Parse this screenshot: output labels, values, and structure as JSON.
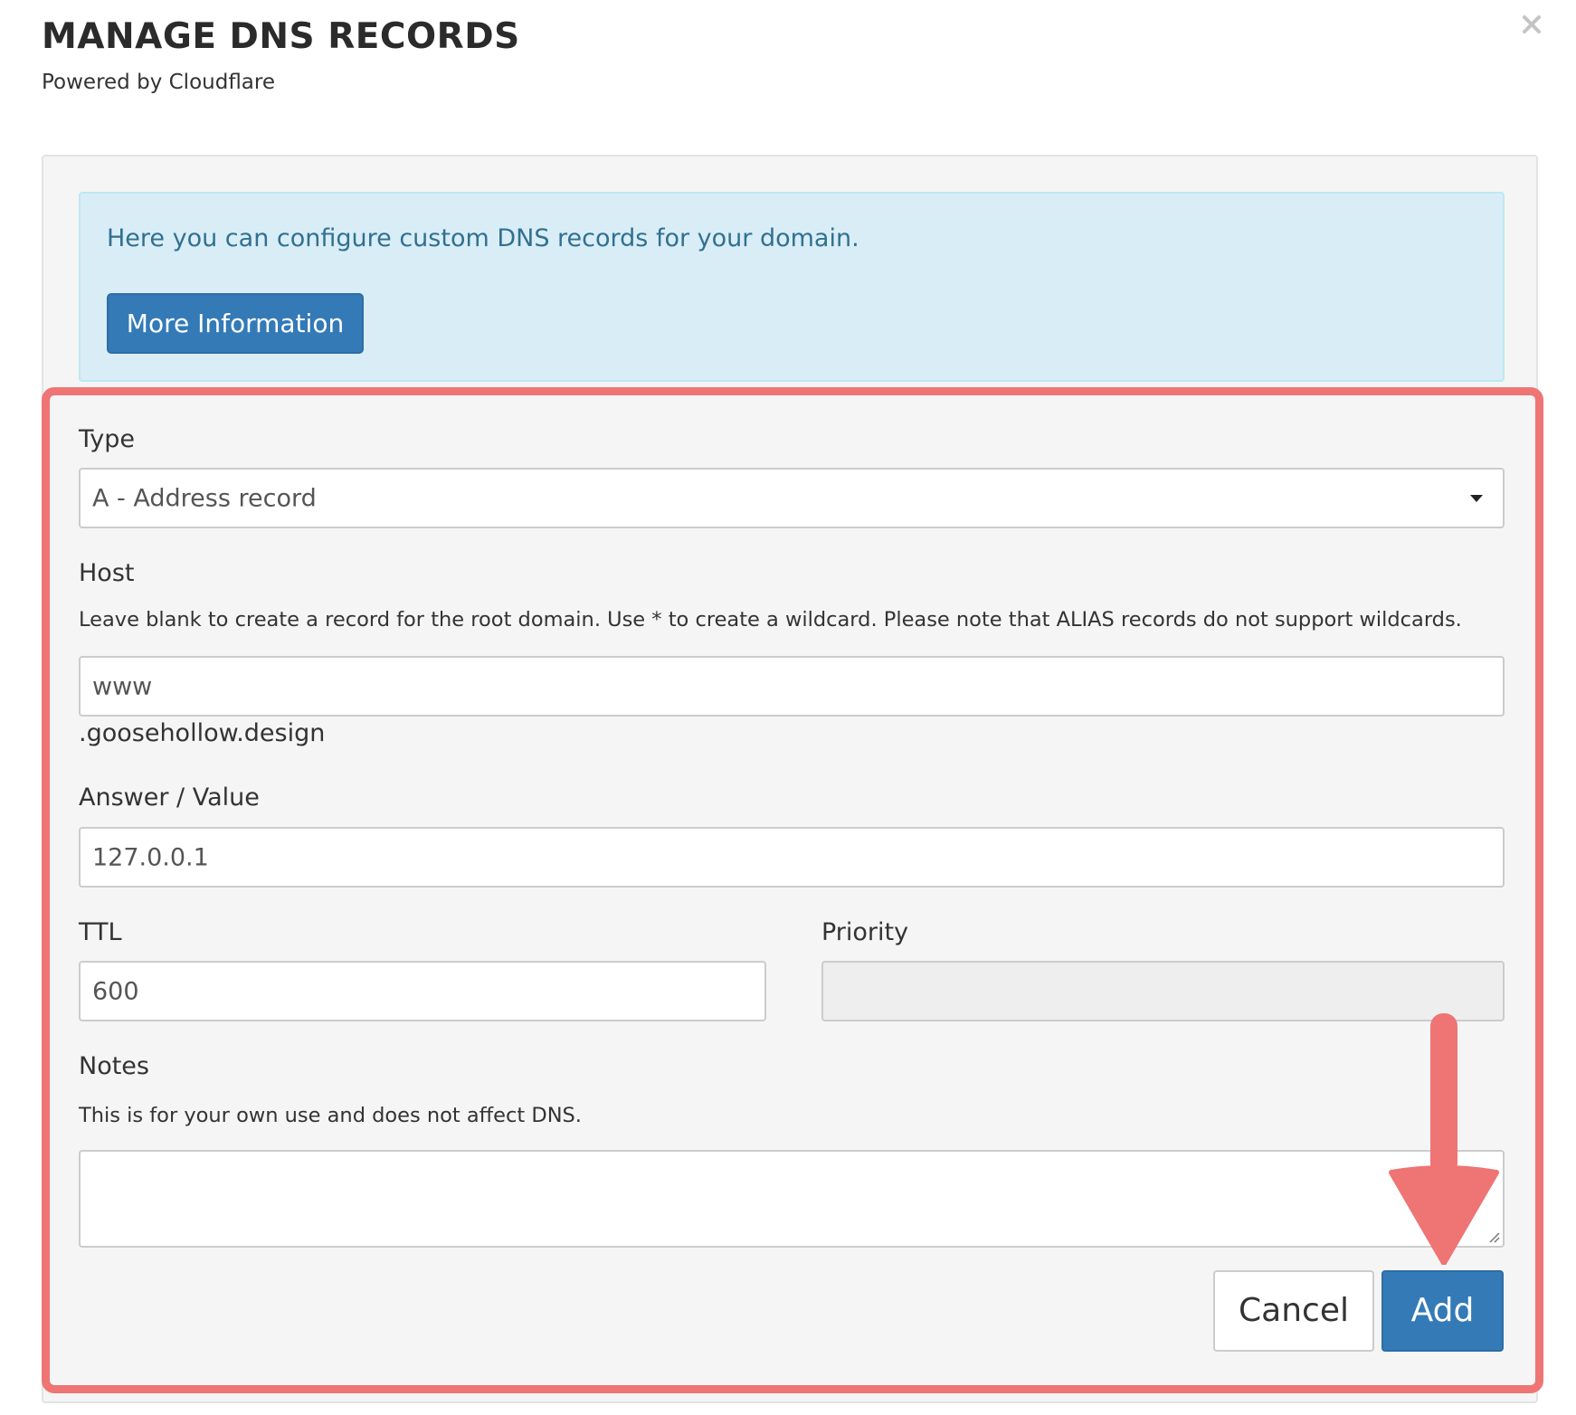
{
  "modal": {
    "title": "MANAGE DNS RECORDS",
    "subtitle": "Powered by Cloudflare",
    "close_icon": "close-icon"
  },
  "info": {
    "text": "Here you can configure custom DNS records for your domain.",
    "button_label": "More Information",
    "background_color": "#d9edf7",
    "text_color": "#31708f"
  },
  "form": {
    "type": {
      "label": "Type",
      "value": "A - Address record"
    },
    "host": {
      "label": "Host",
      "help": "Leave blank to create a record for the root domain. Use * to create a wildcard. Please note that ALIAS records do not support wildcards.",
      "value": "www",
      "suffix": ".goosehollow.design"
    },
    "answer": {
      "label": "Answer / Value",
      "value": "127.0.0.1"
    },
    "ttl": {
      "label": "TTL",
      "value": "600"
    },
    "priority": {
      "label": "Priority",
      "value": ""
    },
    "notes": {
      "label": "Notes",
      "help": "This is for your own use and does not affect DNS.",
      "value": ""
    }
  },
  "actions": {
    "cancel_label": "Cancel",
    "add_label": "Add",
    "primary_color": "#337ab7"
  },
  "annotation": {
    "highlight_color": "#ef7474",
    "arrow_icon": "arrow-down-icon"
  }
}
